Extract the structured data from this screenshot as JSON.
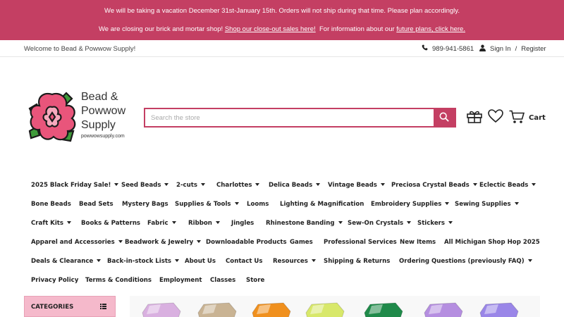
{
  "banner": {
    "line1": "We will be taking a vacation December 31st-January 15th. Orders will not ship during that time. Please plan accordingly.",
    "line2_prefix": "We are closing our brick and mortar shop! ",
    "line2_link1": "Shop our close-out sales here!",
    "line2_middle": "  For information about our ",
    "line2_link2": "future plans, click here. ",
    "bg_color": "#c43f63"
  },
  "util": {
    "welcome": "Welcome to Bead & Powwow Supply!",
    "phone": "989-941-5861",
    "sign_in": "Sign In",
    "separator": "/",
    "register": "Register"
  },
  "logo": {
    "line1": "Bead &",
    "line2": "Powwow",
    "line3": "Supply",
    "domain": "powwowsupply.com"
  },
  "search": {
    "placeholder": "Search the store"
  },
  "header": {
    "cart_label": "Cart"
  },
  "nav": {
    "rows": [
      [
        {
          "label": "2025 Black Friday Sale!",
          "caret": true
        },
        {
          "label": "Seed Beads",
          "caret": true
        },
        {
          "label": "2-cuts",
          "caret": true
        },
        {
          "label": "Charlottes",
          "caret": true
        },
        {
          "label": "Delica Beads",
          "caret": true
        },
        {
          "label": "Vintage Beads",
          "caret": true
        },
        {
          "label": "Preciosa Crystal Beads",
          "caret": true
        },
        {
          "label": "Eclectic Beads",
          "caret": true
        }
      ],
      [
        {
          "label": "Bone Beads",
          "caret": false
        },
        {
          "label": "Bead Sets",
          "caret": false
        },
        {
          "label": "Mystery Bags",
          "caret": false
        },
        {
          "label": "Supplies & Tools",
          "caret": true
        },
        {
          "label": "Looms",
          "caret": false
        },
        {
          "label": "Lighting & Magnification",
          "caret": false
        },
        {
          "label": "Embroidery Supplies",
          "caret": true
        },
        {
          "label": "Sewing Supplies",
          "caret": true
        }
      ],
      [
        {
          "label": "Craft Kits",
          "caret": true
        },
        {
          "label": "Books & Patterns",
          "caret": false
        },
        {
          "label": "Fabric",
          "caret": true
        },
        {
          "label": "Ribbon",
          "caret": true
        },
        {
          "label": "Jingles",
          "caret": false
        },
        {
          "label": "Rhinestone Banding",
          "caret": true
        },
        {
          "label": "Sew-On Crystals",
          "caret": true
        },
        {
          "label": "Stickers",
          "caret": true
        }
      ],
      [
        {
          "label": "Apparel and Accessories",
          "caret": true
        },
        {
          "label": "Beadwork & Jewelry",
          "caret": true
        },
        {
          "label": "Downloadable Products",
          "caret": false
        },
        {
          "label": "Games",
          "caret": false
        },
        {
          "label": "Professional Services",
          "caret": false
        },
        {
          "label": "New Items",
          "caret": false
        },
        {
          "label": "All Michigan Shop Hop 2025",
          "caret": false
        }
      ],
      [
        {
          "label": "Deals & Clearance",
          "caret": true
        },
        {
          "label": "Back-in-stock Lists",
          "caret": true
        },
        {
          "label": "About Us",
          "caret": false
        },
        {
          "label": "Contact Us",
          "caret": false
        },
        {
          "label": "Resources",
          "caret": true
        },
        {
          "label": "Shipping & Returns",
          "caret": false
        },
        {
          "label": "Ordering Questions (previously FAQ)",
          "caret": true
        }
      ],
      [
        {
          "label": "Privacy Policy",
          "caret": false
        },
        {
          "label": "Terms & Conditions",
          "caret": false
        },
        {
          "label": "Employment",
          "caret": false
        },
        {
          "label": "Classes",
          "caret": false
        },
        {
          "label": "Store",
          "caret": false
        }
      ]
    ]
  },
  "categories": {
    "label": "CATEGORIES"
  },
  "products": {
    "gem_colors": [
      "#d9b0e0",
      "#c9b393",
      "#f0901e",
      "#d8e86a",
      "#1f8a4a",
      "#b58ee0",
      "#9a86e8"
    ]
  },
  "colors": {
    "accent": "#c43f63",
    "categories_bg": "#f5b9cb",
    "logo_petal": "#e9557b",
    "logo_leaf": "#3f9b3a"
  }
}
